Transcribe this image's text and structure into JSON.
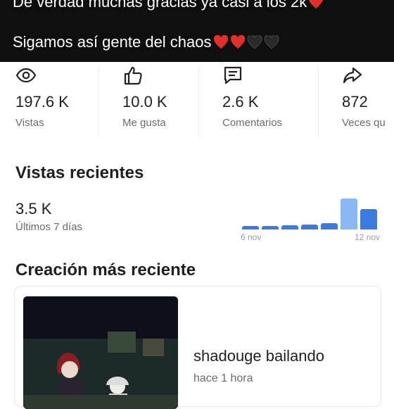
{
  "caption": {
    "line1": "De verdad muchas gracias ya casi a los 2k",
    "line2": "Sigamos así gente del chaos"
  },
  "stats": [
    {
      "icon": "eye-icon",
      "value": "197.6 K",
      "label": "Vistas"
    },
    {
      "icon": "thumbs-up-icon",
      "value": "10.0 K",
      "label": "Me gusta"
    },
    {
      "icon": "comment-icon",
      "value": "2.6 K",
      "label": "Comentarios"
    },
    {
      "icon": "share-icon",
      "value": "872",
      "label": "Veces qu"
    }
  ],
  "recent_views": {
    "title": "Vistas recientes",
    "value": "3.5 K",
    "period": "Últimos 7 días",
    "tick_start": "6 nov",
    "tick_end": "12 nov",
    "daily_relative": [
      0.1,
      0.1,
      0.12,
      0.16,
      0.2,
      0.95,
      0.62
    ],
    "bar_color": "#3b7be0",
    "highlight_color": "#8ab8f4"
  },
  "latest": {
    "title": "Creación más reciente",
    "video_title": "shadouge bailando",
    "time_ago": "hace 1 hora"
  },
  "colors": {
    "caption_bg": "#0f0f0f",
    "heart_red": "#e0302b",
    "heart_black": "#2a2a2a"
  }
}
